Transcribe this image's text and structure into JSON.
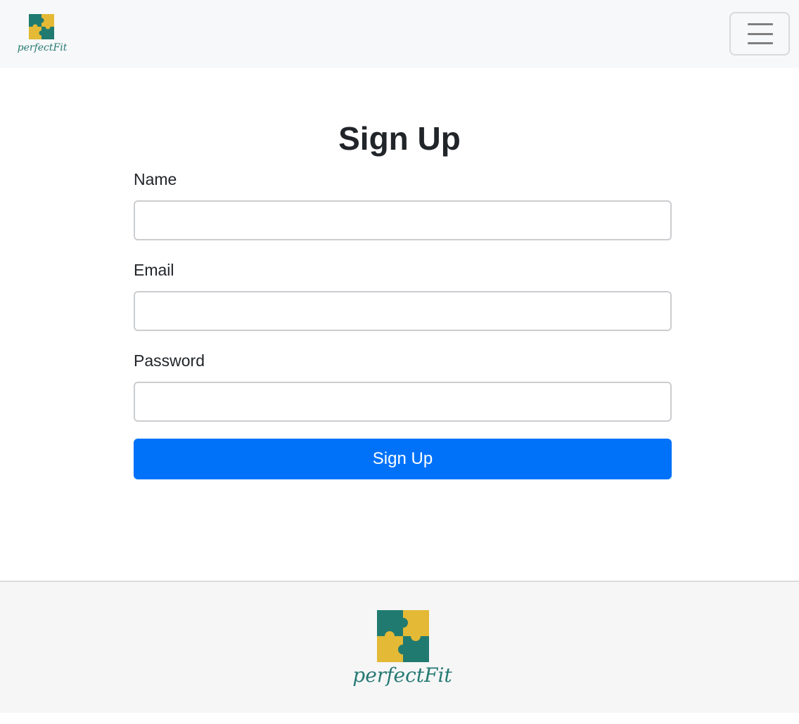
{
  "brand": {
    "wordmark": "perfectFit",
    "colors": {
      "teal": "#217a70",
      "gold": "#e3b935",
      "text": "#267a73"
    }
  },
  "header": {
    "menu_icon": "hamburger-menu-icon"
  },
  "form": {
    "title": "Sign Up",
    "fields": [
      {
        "label": "Name",
        "value": "",
        "placeholder": ""
      },
      {
        "label": "Email",
        "value": "",
        "placeholder": ""
      },
      {
        "label": "Password",
        "value": "",
        "placeholder": ""
      }
    ],
    "submit_label": "Sign Up",
    "accent": "#0072fa"
  }
}
